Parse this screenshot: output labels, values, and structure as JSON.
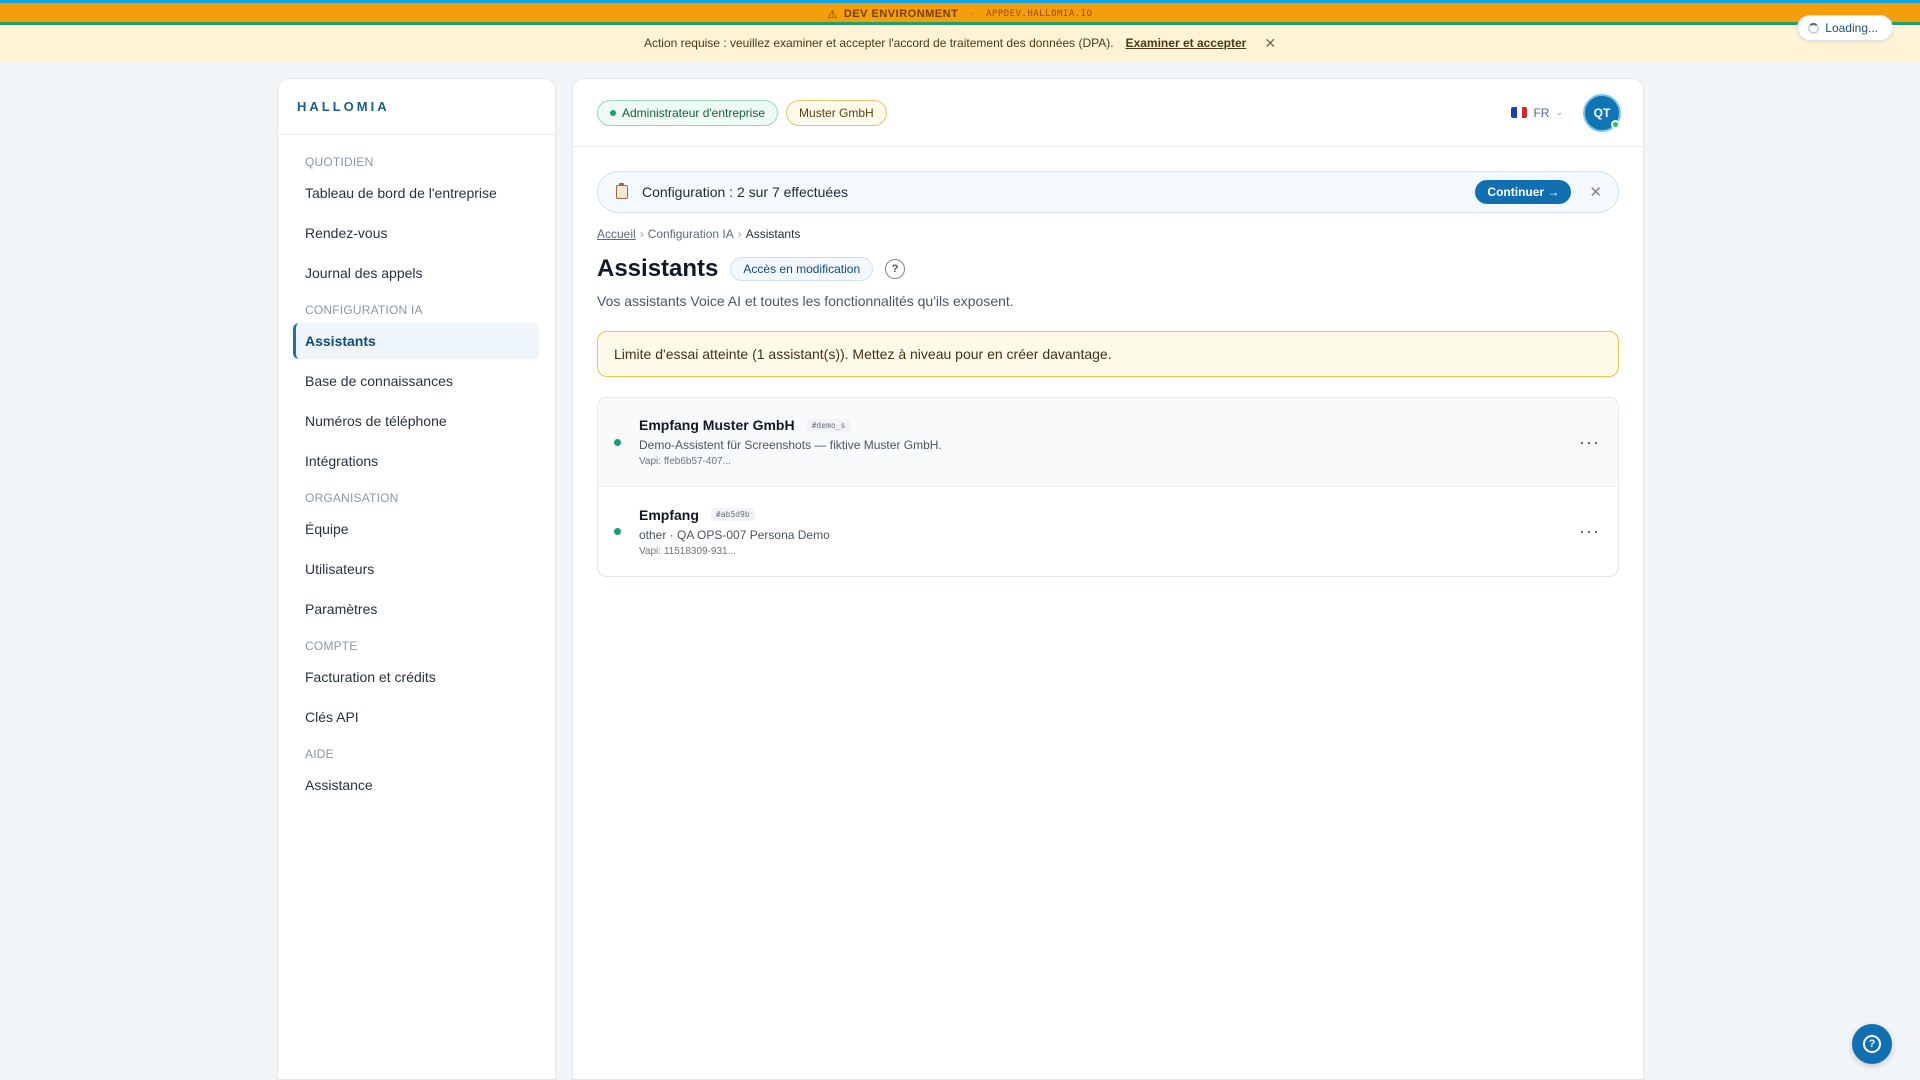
{
  "dev_banner": {
    "label": "DEV ENVIRONMENT",
    "separator": "·",
    "host": "APPDEV.HALLOMIA.IO",
    "icon": "warning-icon"
  },
  "dpa_bar": {
    "message": "Action requise : veuillez examiner et accepter l'accord de traitement des données (DPA).",
    "link": "Examiner et accepter",
    "close_icon": "close-icon"
  },
  "loading": {
    "label": "Loading..."
  },
  "sidebar": {
    "brand": "HALLOMIA",
    "sections": [
      {
        "title": "QUOTIDIEN",
        "items": [
          "Tableau de bord de l'entreprise",
          "Rendez-vous",
          "Journal des appels"
        ]
      },
      {
        "title": "CONFIGURATION IA",
        "items": [
          "Assistants",
          "Base de connaissances",
          "Numéros de téléphone",
          "Intégrations"
        ]
      },
      {
        "title": "ORGANISATION",
        "items": [
          "Équipe",
          "Utilisateurs",
          "Paramètres"
        ]
      },
      {
        "title": "COMPTE",
        "items": [
          "Facturation et crédits",
          "Clés API"
        ]
      },
      {
        "title": "AIDE",
        "items": [
          "Assistance"
        ]
      }
    ],
    "active_item": "Assistants"
  },
  "topbar": {
    "role_badge": "Administrateur d'entreprise",
    "company_badge": "Muster GmbH",
    "language": "FR",
    "avatar_initials": "QT",
    "flag_colors": [
      "#1f3fa8",
      "#ffffff",
      "#d8232a"
    ]
  },
  "setup": {
    "text": "Configuration : 2 sur 7 effectuées",
    "button": "Continuer →",
    "close": "✕"
  },
  "breadcrumb": {
    "items": [
      "Accueil",
      "Configuration IA"
    ],
    "current": "Assistants",
    "separator": "›"
  },
  "page": {
    "title": "Assistants",
    "access_badge": "Accès en modification",
    "help": "?",
    "subtitle": "Vos assistants Voice AI et toutes les fonctionnalités qu'ils exposent."
  },
  "limit_alert": "Limite d'essai atteinte (1 assistant(s)). Mettez à niveau pour en créer davantage.",
  "assistants": [
    {
      "name": "Empfang Muster GmbH",
      "tag": "#demo_s",
      "desc": "Demo-Assistent für Screenshots — fiktive Muster GmbH.",
      "vapi": "Vapi: ffeb6b57-407...",
      "status": "active"
    },
    {
      "name": "Empfang",
      "tag": "#ab5d9b",
      "desc": "other · QA OPS-007 Persona Demo",
      "vapi": "Vapi: 11518309-931...",
      "status": "active"
    }
  ],
  "more_label": "···",
  "help_fab": "?"
}
